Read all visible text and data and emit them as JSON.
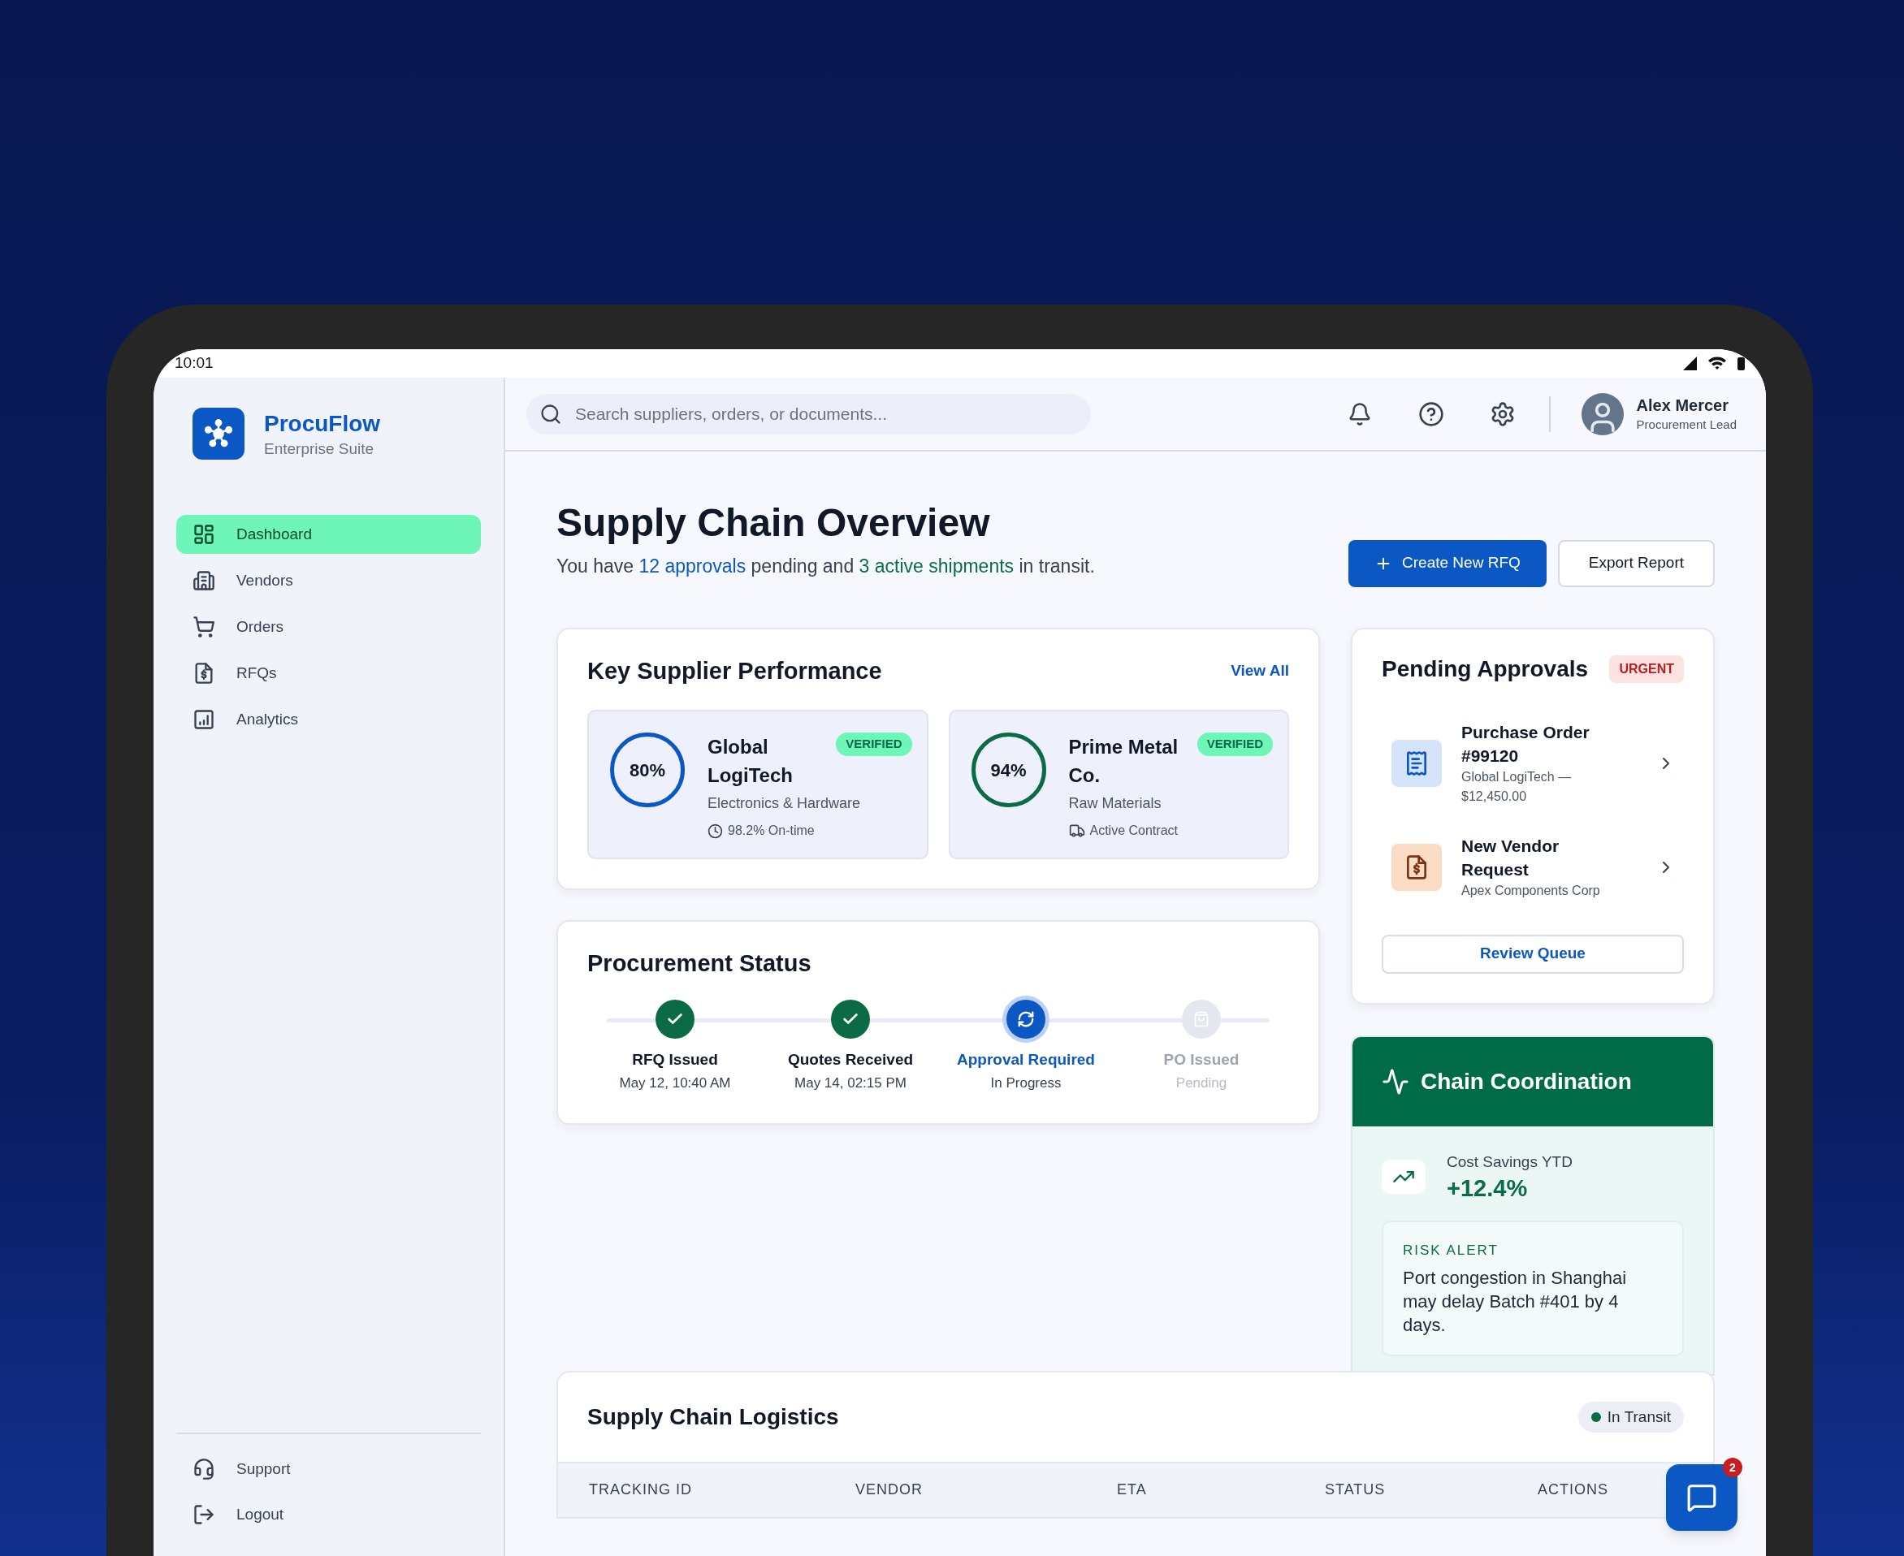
{
  "status_bar": {
    "time": "10:01"
  },
  "brand": {
    "name": "ProcuFlow",
    "subtitle": "Enterprise Suite"
  },
  "sidebar": {
    "items": [
      {
        "label": "Dashboard",
        "selected": true
      },
      {
        "label": "Vendors",
        "selected": false
      },
      {
        "label": "Orders",
        "selected": false
      },
      {
        "label": "RFQs",
        "selected": false
      },
      {
        "label": "Analytics",
        "selected": false
      }
    ],
    "footer_items": [
      {
        "label": "Support"
      },
      {
        "label": "Logout"
      }
    ]
  },
  "header": {
    "search": {
      "placeholder": "Search suppliers, orders, or documents..."
    },
    "user": {
      "name": "Alex Mercer",
      "role": "Procurement Lead"
    }
  },
  "page": {
    "title": "Supply Chain Overview",
    "subtitle_parts": [
      {
        "text": "You have ",
        "kind": "plain"
      },
      {
        "text": "12 approvals",
        "kind": "approvals"
      },
      {
        "text": " pending and ",
        "kind": "plain"
      },
      {
        "text": "3 active shipments",
        "kind": "shipments"
      },
      {
        "text": " in transit.",
        "kind": "plain"
      }
    ],
    "buttons": [
      {
        "label": "Create New RFQ",
        "kind": "primary"
      },
      {
        "label": "Export Report",
        "kind": "secondary"
      }
    ]
  },
  "supplier_performance": {
    "title": "Key Supplier Performance",
    "link": "View All",
    "suppliers": [
      {
        "name": "Global LogiTech",
        "score": "80%",
        "color": "#0b57c4",
        "badge": "VERIFIED",
        "category": "Electronics & Hardware",
        "meta": "98.2% On-time",
        "kind": "clock"
      },
      {
        "name": "Prime Metal Co.",
        "score": "94%",
        "color": "#0b6b45",
        "badge": "VERIFIED",
        "category": "Raw Materials",
        "meta": "Active Contract",
        "kind": "truck"
      }
    ]
  },
  "procurement_status": {
    "title": "Procurement Status",
    "steps": [
      {
        "label": "RFQ Issued",
        "detail": "May 12, 10:40 AM",
        "kind": "done"
      },
      {
        "label": "Quotes Received",
        "detail": "May 14, 02:15 PM",
        "kind": "done"
      },
      {
        "label": "Approval Required",
        "detail": "In Progress",
        "kind": "active"
      },
      {
        "label": "PO Issued",
        "detail": "Pending",
        "kind": "pending"
      }
    ]
  },
  "pending_approvals": {
    "title": "Pending Approvals",
    "badge": "URGENT",
    "items": [
      {
        "title": "Purchase Order #99120",
        "subtitle": "Global LogiTech — $12,450.00",
        "kind": "order"
      },
      {
        "title": "New Vendor Request",
        "subtitle": "Apex Components Corp",
        "kind": "vendor"
      }
    ],
    "button": "Review Queue"
  },
  "chain_coordination": {
    "title": "Chain Coordination",
    "metric_label": "Cost Savings YTD",
    "metric_value": "+12.4%",
    "alert_label": "RISK ALERT",
    "alert_text": "Port congestion in Shanghai may delay Batch #401 by 4 days."
  },
  "logistics": {
    "title": "Supply Chain Logistics",
    "status": "In Transit",
    "columns": [
      "TRACKING ID",
      "VENDOR",
      "ETA",
      "STATUS",
      "ACTIONS"
    ]
  },
  "chat": {
    "badge": "2"
  }
}
